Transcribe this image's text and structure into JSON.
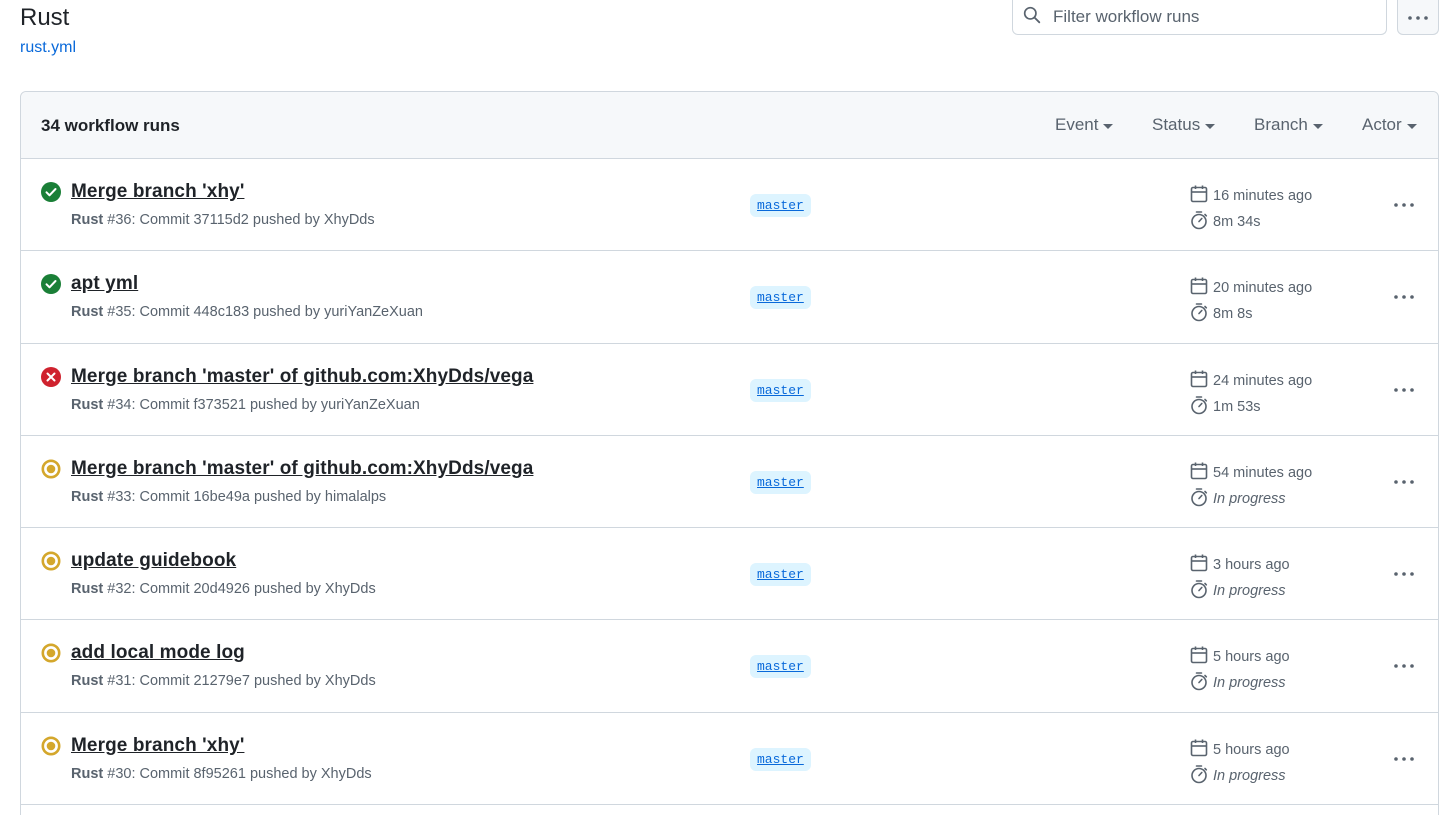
{
  "header": {
    "title": "Rust",
    "workflow_file": "rust.yml",
    "search_placeholder": "Filter workflow runs"
  },
  "runs_header": {
    "count_label": "34 workflow runs",
    "filters": [
      "Event",
      "Status",
      "Branch",
      "Actor"
    ]
  },
  "colors": {
    "success": "#1a7f37",
    "failure": "#cf222e",
    "in_progress": "#d4a72c",
    "link": "#0969da",
    "branch_bg": "#ddf4ff"
  },
  "runs": [
    {
      "status": "success",
      "title": "Merge branch 'xhy'",
      "workflow": "Rust",
      "number": "#36",
      "meta": ": Commit 37115d2 pushed by XhyDds",
      "branch": "master",
      "started": "16 minutes ago",
      "duration": "8m 34s"
    },
    {
      "status": "success",
      "title": "apt yml",
      "workflow": "Rust",
      "number": "#35",
      "meta": ": Commit 448c183 pushed by yuriYanZeXuan",
      "branch": "master",
      "started": "20 minutes ago",
      "duration": "8m 8s"
    },
    {
      "status": "failure",
      "title": "Merge branch 'master' of github.com:XhyDds/vega",
      "workflow": "Rust",
      "number": "#34",
      "meta": ": Commit f373521 pushed by yuriYanZeXuan",
      "branch": "master",
      "started": "24 minutes ago",
      "duration": "1m 53s"
    },
    {
      "status": "in_progress",
      "title": "Merge branch 'master' of github.com:XhyDds/vega",
      "workflow": "Rust",
      "number": "#33",
      "meta": ": Commit 16be49a pushed by himalalps",
      "branch": "master",
      "started": "54 minutes ago",
      "duration": "In progress"
    },
    {
      "status": "in_progress",
      "title": "update guidebook",
      "workflow": "Rust",
      "number": "#32",
      "meta": ": Commit 20d4926 pushed by XhyDds",
      "branch": "master",
      "started": "3 hours ago",
      "duration": "In progress"
    },
    {
      "status": "in_progress",
      "title": "add local mode log",
      "workflow": "Rust",
      "number": "#31",
      "meta": ": Commit 21279e7 pushed by XhyDds",
      "branch": "master",
      "started": "5 hours ago",
      "duration": "In progress"
    },
    {
      "status": "in_progress",
      "title": "Merge branch 'xhy'",
      "workflow": "Rust",
      "number": "#30",
      "meta": ": Commit 8f95261 pushed by XhyDds",
      "branch": "master",
      "started": "5 hours ago",
      "duration": "In progress"
    }
  ]
}
